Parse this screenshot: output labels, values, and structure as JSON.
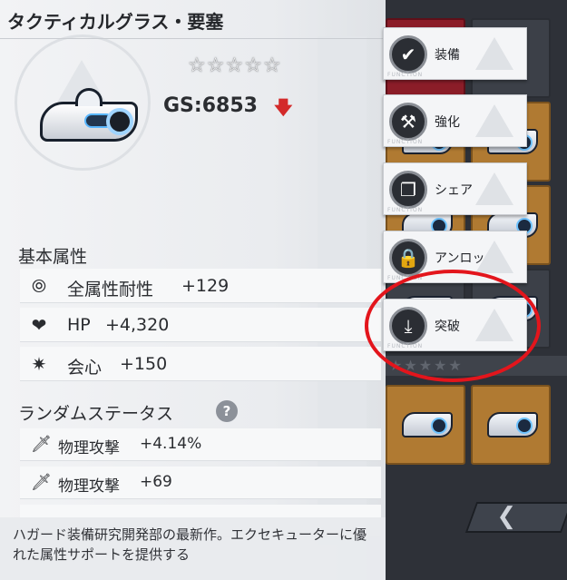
{
  "header": {
    "title": "タクティカルグラス・要塞"
  },
  "item": {
    "stars": [
      "☆",
      "☆",
      "☆",
      "☆",
      "☆"
    ],
    "gear_score": "GS:6853",
    "gear_score_trend": "down"
  },
  "basic_attributes": {
    "heading": "基本属性",
    "stats": [
      {
        "icon": "all-resist-icon",
        "name": "全属性耐性",
        "value": "+129"
      },
      {
        "icon": "heart-icon",
        "name": "HP",
        "value": "+4,320"
      },
      {
        "icon": "crit-burst-icon",
        "name": "会心",
        "value": "+150"
      }
    ]
  },
  "random_status": {
    "heading": "ランダムステータス",
    "help": "?",
    "stats": [
      {
        "icon": "sword-icon",
        "name": "物理攻撃",
        "value": "+4.14%"
      },
      {
        "icon": "sword-icon",
        "name": "物理攻撃",
        "value": "+69"
      }
    ]
  },
  "description": "ハガード装備研究開発部の最新作。エクセキューターに優れた属性サポートを提供する",
  "functions": [
    {
      "label": "装備",
      "icon": "check-icon",
      "sub": "FUNCTION"
    },
    {
      "label": "強化",
      "icon": "hammer-icon",
      "sub": "FUNCTION"
    },
    {
      "label": "シェア",
      "icon": "share-icon",
      "sub": "FUNCTION"
    },
    {
      "label": "アンロック",
      "icon": "lock-icon",
      "sub": "FUNCTION"
    },
    {
      "label": "突破",
      "icon": "download-tray-icon",
      "sub": "FUNCTION"
    }
  ],
  "inventory": {
    "empty_stars": "★★★★★",
    "back_glyph": "❮"
  },
  "colors": {
    "panel_bg": "#eef0f2",
    "gold_slot": "#b07a32",
    "highlight_red": "#e3151c",
    "gs_down_arrow": "#d32a2a"
  }
}
